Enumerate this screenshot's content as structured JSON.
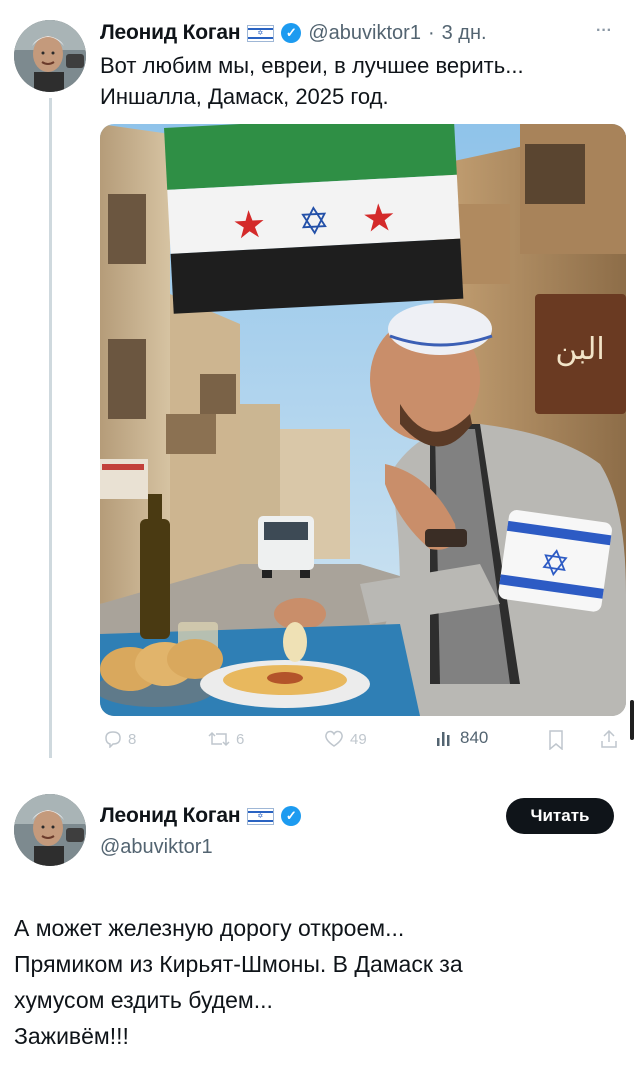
{
  "tweet": {
    "author_name": "Леонид Коган",
    "handle": "@abuviktor1",
    "separator": "·",
    "time": "3 дн.",
    "more": "···",
    "text_line1": "Вот любим мы, евреи, в лучшее верить...",
    "text_line2": "Иншалла, Дамаск, 2025 год.",
    "image_sign_text": "البن",
    "metrics": {
      "replies": "8",
      "retweets": "6",
      "likes": "49",
      "views": "840"
    }
  },
  "profile": {
    "author_name": "Леонид Коган",
    "handle": "@abuviktor1",
    "follow_label": "Читать"
  },
  "comment": {
    "line1": "А может железную дорогу откроем...",
    "line2": "Прямиком из Кирьят-Шмоны. В Дамаск за",
    "line3": "хумусом ездить будем...",
    "line4": "Заживём!!!"
  },
  "colors": {
    "verified": "#1d9bf0",
    "text": "#0f1419",
    "secondary": "#536471",
    "follow_bg": "#0f1419"
  }
}
